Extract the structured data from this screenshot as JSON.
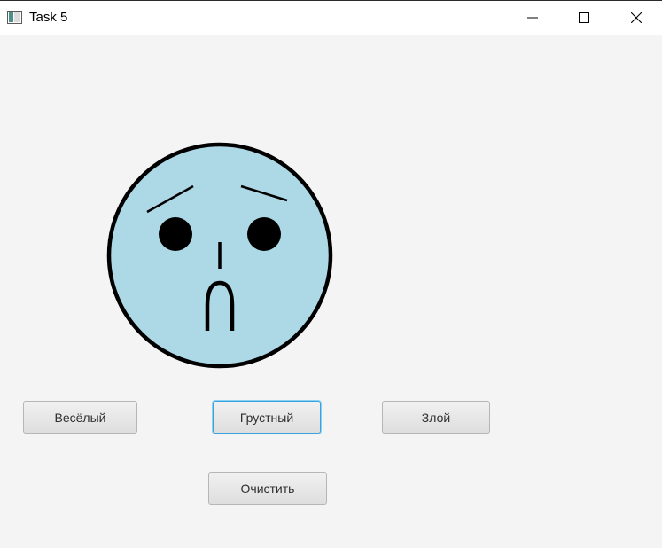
{
  "window": {
    "title": "Task 5",
    "icon": "java-window-icon",
    "controls": [
      "minimize-icon",
      "maximize-icon",
      "close-icon"
    ]
  },
  "face": {
    "expression": "sad",
    "fill_color": "#add8e6",
    "outline_color": "#000000"
  },
  "buttons": {
    "happy": "Весёлый",
    "sad": "Грустный",
    "angry": "Злой",
    "clear": "Очистить"
  },
  "focused_button": "sad",
  "colors": {
    "background": "#f4f4f4",
    "focus_ring": "#3aa2dc"
  }
}
